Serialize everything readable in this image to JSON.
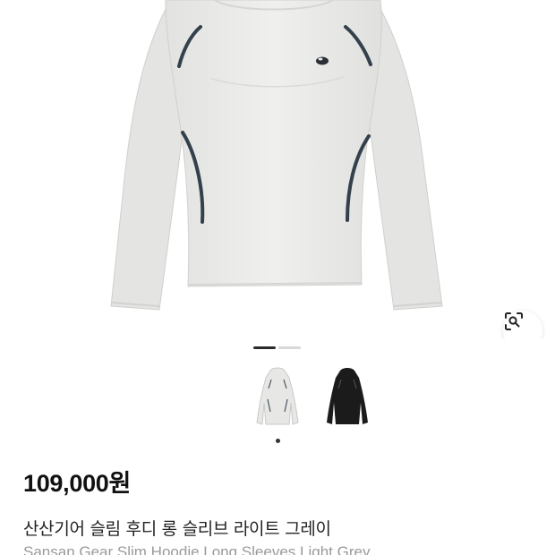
{
  "product": {
    "price": "109,000원",
    "title_ko": "산산기어 슬림 후디 롱 슬리브 라이트 그레이",
    "title_en": "Sansan Gear Slim Hoodie Long Sleeves Light Grey",
    "main_image": "light-grey-slim-hoodie-front",
    "color_options": [
      {
        "name": "light-grey",
        "color": "#e7e8e6",
        "selected": true
      },
      {
        "name": "black",
        "color": "#1b1b1b",
        "selected": false
      }
    ]
  },
  "gallery": {
    "page_count": 2,
    "current_page": 1
  },
  "icons": {
    "lens": "image-search-icon"
  },
  "colors": {
    "accent_piping": "#34404c",
    "garment": "#e9eae8"
  }
}
